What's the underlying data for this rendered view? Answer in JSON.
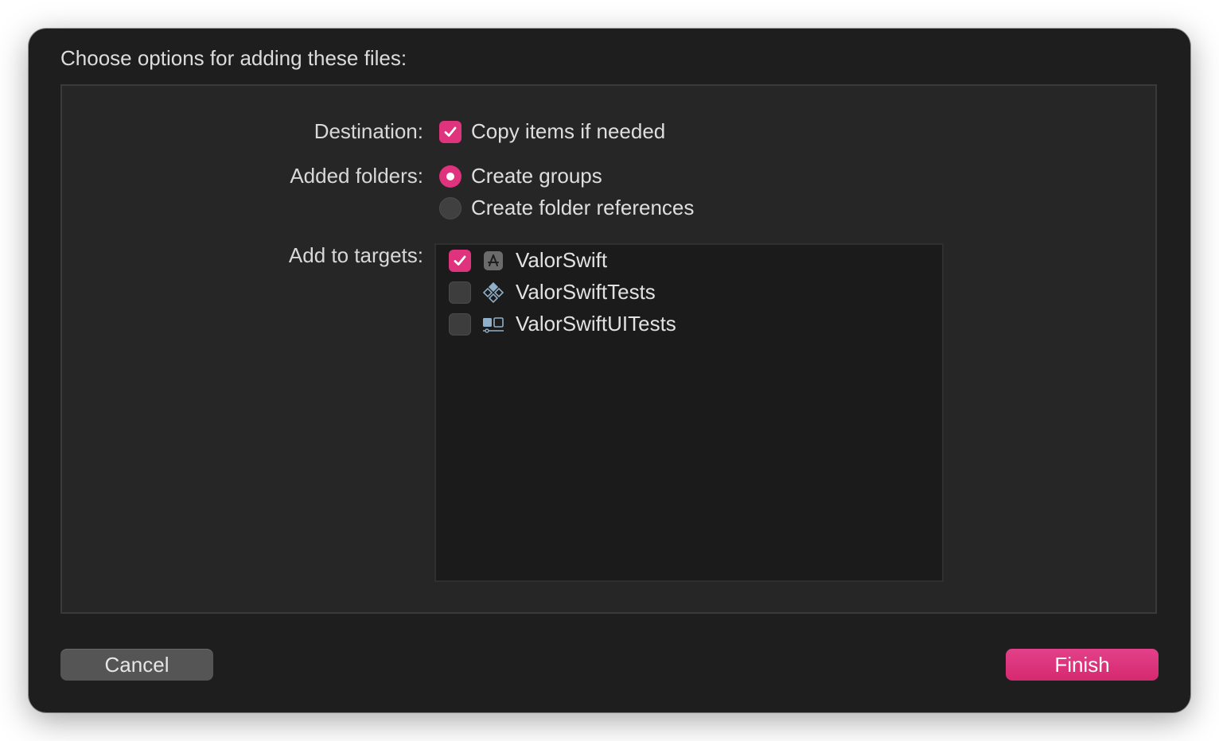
{
  "dialog": {
    "title": "Choose options for adding these files:"
  },
  "destination": {
    "label": "Destination:",
    "option_text": "Copy items if needed",
    "checked": true
  },
  "added_folders": {
    "label": "Added folders:",
    "options": [
      {
        "text": "Create groups",
        "selected": true
      },
      {
        "text": "Create folder references",
        "selected": false
      }
    ]
  },
  "targets": {
    "label": "Add to targets:",
    "items": [
      {
        "name": "ValorSwift",
        "checked": true,
        "icon": "app-target-icon"
      },
      {
        "name": "ValorSwiftTests",
        "checked": false,
        "icon": "unit-test-target-icon"
      },
      {
        "name": "ValorSwiftUITests",
        "checked": false,
        "icon": "ui-test-target-icon"
      }
    ]
  },
  "buttons": {
    "cancel": "Cancel",
    "finish": "Finish"
  },
  "colors": {
    "accent": "#e0337d",
    "sheet_background": "#1e1e1e",
    "panel_background": "#262626"
  }
}
